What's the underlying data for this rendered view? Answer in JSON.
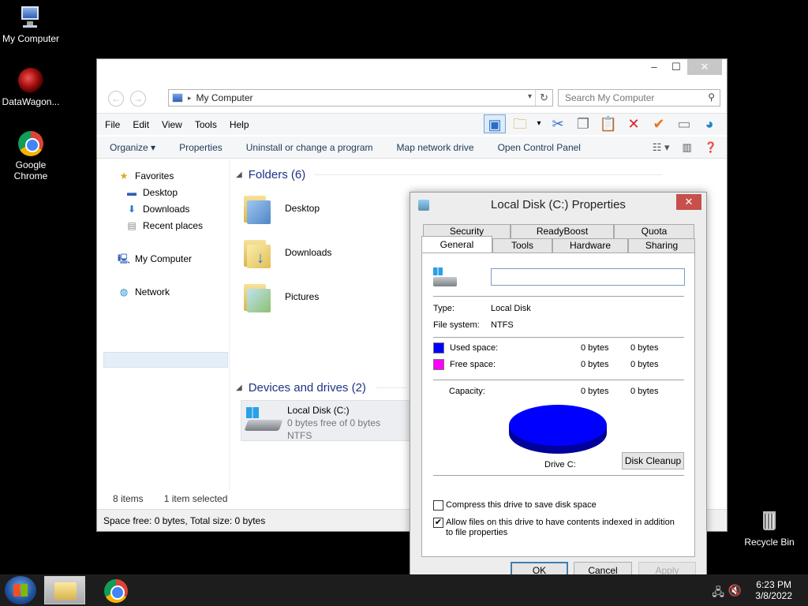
{
  "desktop": {
    "icons": [
      {
        "label": "My Computer"
      },
      {
        "label": "DataWagon..."
      },
      {
        "label": "Google\nChrome"
      },
      {
        "label": "Recycle Bin"
      }
    ]
  },
  "explorer": {
    "window_controls": {
      "minimize": "–",
      "maximize": "☐",
      "close": "✕"
    },
    "address": {
      "crumb": "My Computer"
    },
    "search": {
      "placeholder": "Search My Computer"
    },
    "menu": [
      "File",
      "Edit",
      "View",
      "Tools",
      "Help"
    ],
    "commands": [
      "Organize ▾",
      "Properties",
      "Uninstall or change a program",
      "Map network drive",
      "Open Control Panel"
    ],
    "nav": {
      "favorites": "Favorites",
      "desktop": "Desktop",
      "downloads": "Downloads",
      "recent": "Recent places",
      "computer": "My Computer",
      "network": "Network"
    },
    "groups": {
      "folders": "Folders (6)",
      "devices": "Devices and drives (2)"
    },
    "folders": [
      "Desktop",
      "Downloads",
      "Pictures"
    ],
    "drive": {
      "name": "Local Disk (C:)",
      "free": "0 bytes free of 0 bytes",
      "fs": "NTFS"
    },
    "status": {
      "items": "8 items",
      "selected": "1 item selected",
      "space": "Space free: 0 bytes, Total size: 0 bytes"
    }
  },
  "dialog": {
    "title": "Local Disk (C:) Properties",
    "tabs_back": [
      "Security",
      "ReadyBoost",
      "Quota"
    ],
    "tabs_front": [
      "General",
      "Tools",
      "Hardware",
      "Sharing"
    ],
    "name_value": "",
    "type_label": "Type:",
    "type_value": "Local Disk",
    "fs_label": "File system:",
    "fs_value": "NTFS",
    "used_label": "Used space:",
    "used_bytes": "0 bytes",
    "used_size": "0 bytes",
    "free_label": "Free space:",
    "free_bytes": "0 bytes",
    "free_size": "0 bytes",
    "capacity_label": "Capacity:",
    "capacity_bytes": "0 bytes",
    "capacity_size": "0 bytes",
    "drive_label": "Drive C:",
    "cleanup": "Disk Cleanup",
    "compress": "Compress this drive to save disk space",
    "index": "Allow files on this drive to have contents indexed in addition to file properties",
    "ok": "OK",
    "cancel": "Cancel",
    "apply": "Apply",
    "colors": {
      "used": "#0000ff",
      "free": "#ff00ff"
    }
  },
  "taskbar": {
    "time": "6:23 PM",
    "date": "3/8/2022"
  }
}
